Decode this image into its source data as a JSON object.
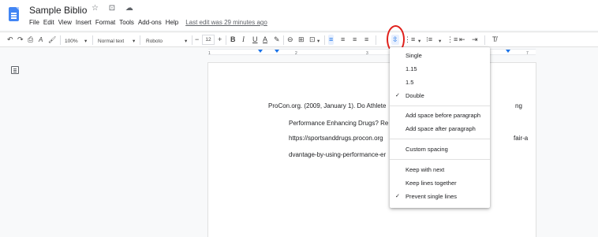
{
  "doc": {
    "title": "Sample Biblio",
    "title_icons": "☆ ⊡ ☁",
    "menus": [
      "File",
      "Edit",
      "View",
      "Insert",
      "Format",
      "Tools",
      "Add-ons",
      "Help"
    ],
    "last_edit": "Last edit was 29 minutes ago"
  },
  "toolbar": {
    "undo": "↶",
    "redo": "↷",
    "print": "⎙",
    "spellcheck": "A",
    "paint_format": "🖌",
    "zoom": "100%",
    "style": "Normal text",
    "font": "Roboto",
    "size_minus": "−",
    "size": "12",
    "size_plus": "+",
    "bold": "B",
    "italic": "I",
    "underline": "U",
    "text_color": "A",
    "highlight": "✎",
    "link": "⊖",
    "comment": "⊞",
    "image": "⊡",
    "align_left": "≡",
    "align_center": "≡",
    "align_right": "≡",
    "justify": "≡",
    "line_spacing": "⇳",
    "checklist": "⋮≡",
    "bullets": "⁝≡",
    "numbered": "⋮≡",
    "indent_less": "⇤",
    "indent_more": "⇥",
    "clear_format": "T̸"
  },
  "ruler": {
    "ticks": [
      "1",
      "2",
      "3",
      "7"
    ]
  },
  "page": {
    "lines": [
      "ProCon.org. (2009, January 1). Do Athlete",
      "ng",
      "Performance Enhancing Drugs? Re",
      "https://sportsanddrugs.procon.org",
      "fair-a",
      "dvantage-by-using-performance-er"
    ]
  },
  "spacing_menu": {
    "items": [
      {
        "label": "Single",
        "checked": false
      },
      {
        "label": "1.15",
        "checked": false
      },
      {
        "label": "1.5",
        "checked": false
      },
      {
        "label": "Double",
        "checked": true
      },
      {
        "label": "Add space before paragraph",
        "checked": false
      },
      {
        "label": "Add space after paragraph",
        "checked": false
      },
      {
        "label": "Custom spacing",
        "checked": false
      },
      {
        "label": "Keep with next",
        "checked": false
      },
      {
        "label": "Keep lines together",
        "checked": false
      },
      {
        "label": "Prevent single lines",
        "checked": true
      }
    ],
    "checkmark": "✓"
  },
  "colors": {
    "accent": "#1a73e8",
    "annotation": "#e0201b",
    "doc_icon": "#4285f4"
  }
}
